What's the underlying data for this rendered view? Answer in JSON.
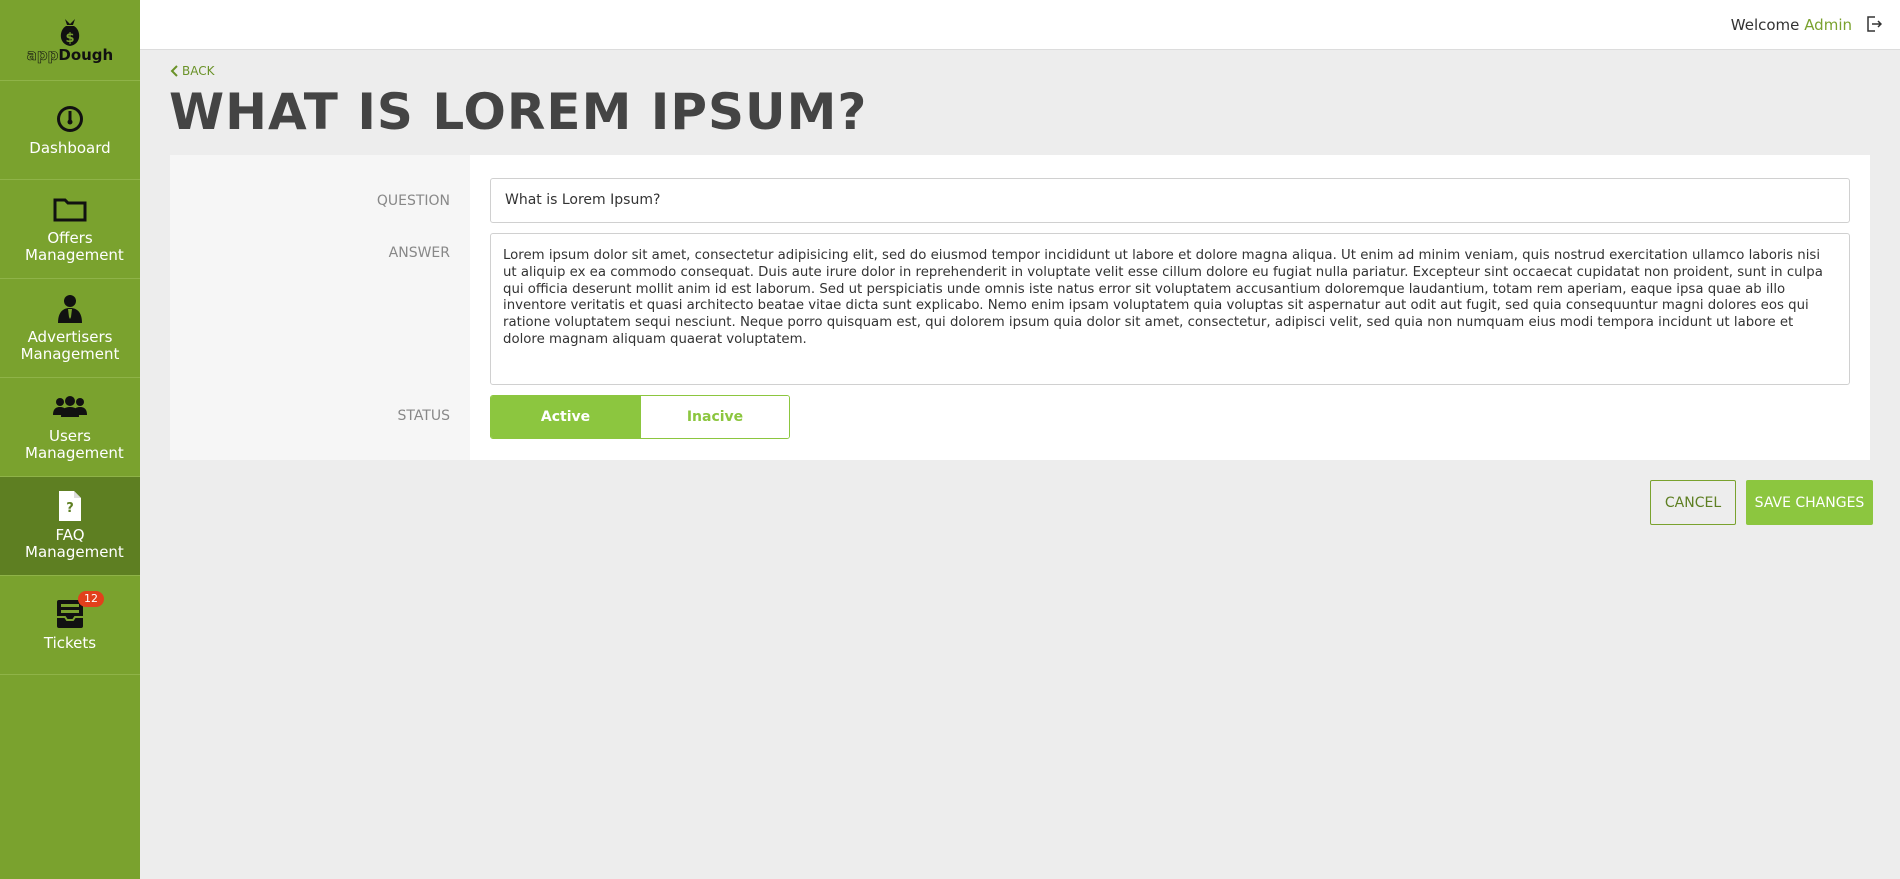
{
  "brand": {
    "logo_part1": "app",
    "logo_part2": "Dough"
  },
  "sidebar": {
    "items": [
      {
        "label": "Dashboard",
        "icon": "dashboard-gauge-icon"
      },
      {
        "label": "Offers Management",
        "icon": "folder-icon"
      },
      {
        "label": "Advertisers Management",
        "icon": "advertiser-person-icon"
      },
      {
        "label": "Users Management",
        "icon": "users-group-icon"
      },
      {
        "label": "FAQ Management",
        "icon": "faq-document-icon",
        "active": true
      },
      {
        "label": "Tickets",
        "icon": "inbox-tray-icon",
        "badge": "12"
      }
    ]
  },
  "header": {
    "welcome": "Welcome",
    "user": "Admin",
    "logout_icon": "logout-icon"
  },
  "page": {
    "back": "BACK",
    "title": "WHAT IS LOREM IPSUM?"
  },
  "form": {
    "question_label": "QUESTION",
    "question_value": "What is Lorem Ipsum?",
    "answer_label": "ANSWER",
    "answer_value": "Lorem ipsum dolor sit amet, consectetur adipisicing elit, sed do eiusmod tempor incididunt ut labore et dolore magna aliqua. Ut enim ad minim veniam, quis nostrud exercitation ullamco laboris nisi ut aliquip ex ea commodo consequat. Duis aute irure dolor in reprehenderit in voluptate velit esse cillum dolore eu fugiat nulla pariatur. Excepteur sint occaecat cupidatat non proident, sunt in culpa qui officia deserunt mollit anim id est laborum. Sed ut perspiciatis unde omnis iste natus error sit voluptatem accusantium doloremque laudantium, totam rem aperiam, eaque ipsa quae ab illo inventore veritatis et quasi architecto beatae vitae dicta sunt explicabo. Nemo enim ipsam voluptatem quia voluptas sit aspernatur aut odit aut fugit, sed quia consequuntur magni dolores eos qui ratione voluptatem sequi nesciunt. Neque porro quisquam est, qui dolorem ipsum quia dolor sit amet, consectetur, adipisci velit, sed quia non numquam eius modi tempora incidunt ut labore et dolore magnam aliquam quaerat voluptatem.",
    "status_label": "STATUS",
    "status_active": "Active",
    "status_inactive": "Inacive"
  },
  "actions": {
    "cancel": "CANCEL",
    "save": "SAVE CHANGES"
  },
  "colors": {
    "sidebar": "#7aa22e",
    "sidebar_active": "#5e7f22",
    "accent": "#8cc63f",
    "badge": "#e2401c"
  }
}
